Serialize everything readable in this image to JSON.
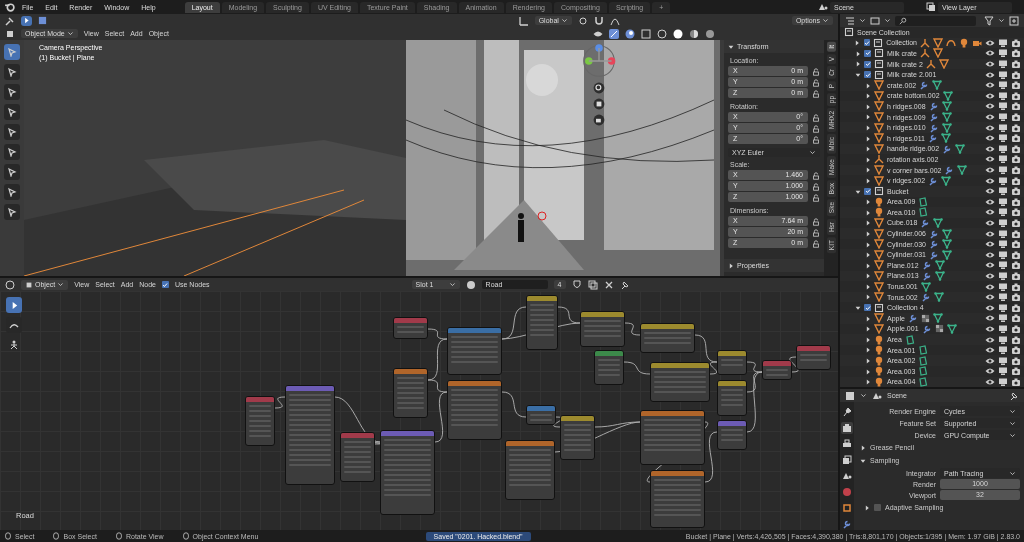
{
  "menu": [
    "File",
    "Edit",
    "Render",
    "Window",
    "Help"
  ],
  "workspaces": [
    {
      "label": "Layout",
      "selected": true
    },
    {
      "label": "Modeling",
      "selected": false
    },
    {
      "label": "Sculpting",
      "selected": false
    },
    {
      "label": "UV Editing",
      "selected": false
    },
    {
      "label": "Texture Paint",
      "selected": false
    },
    {
      "label": "Shading",
      "selected": false
    },
    {
      "label": "Animation",
      "selected": false
    },
    {
      "label": "Rendering",
      "selected": false
    },
    {
      "label": "Compositing",
      "selected": false
    },
    {
      "label": "Scripting",
      "selected": false
    }
  ],
  "add_workspace": "+",
  "scene": {
    "value": "Scene"
  },
  "view_layer": {
    "value": "View Layer"
  },
  "viewport": {
    "mode": "Object Mode",
    "menus": [
      "View",
      "Select",
      "Add",
      "Object"
    ],
    "orientation": "Global",
    "options": "Options",
    "overlay_lines": [
      "Camera Perspective",
      "(1) Bucket | Plane"
    ]
  },
  "transform": {
    "title": "Transform",
    "groups": [
      {
        "label": "Location:",
        "rows": [
          {
            "axis": "X",
            "value": "0 m"
          },
          {
            "axis": "Y",
            "value": "0 m"
          },
          {
            "axis": "Z",
            "value": "0 m"
          }
        ]
      },
      {
        "label": "Rotation:",
        "rows": [
          {
            "axis": "X",
            "value": "0°"
          },
          {
            "axis": "Y",
            "value": "0°"
          },
          {
            "axis": "Z",
            "value": "0°"
          }
        ],
        "mode": "XYZ Euler"
      },
      {
        "label": "Scale:",
        "rows": [
          {
            "axis": "X",
            "value": "1.460"
          },
          {
            "axis": "Y",
            "value": "1.000"
          },
          {
            "axis": "Z",
            "value": "1.000"
          }
        ]
      },
      {
        "label": "Dimensions:",
        "rows": [
          {
            "axis": "X",
            "value": "7.64 m"
          },
          {
            "axis": "Y",
            "value": "20 m"
          },
          {
            "axis": "Z",
            "value": "0 m"
          }
        ]
      }
    ],
    "properties": "Properties"
  },
  "sidebar_tabs": [
    {
      "label": "It",
      "selected": true
    },
    {
      "label": "V",
      "selected": false
    },
    {
      "label": "Cr",
      "selected": false
    },
    {
      "label": "P",
      "selected": false
    },
    {
      "label": "pp",
      "selected": false
    },
    {
      "label": "MHX2",
      "selected": false
    },
    {
      "label": "Mblc",
      "selected": false
    },
    {
      "label": "Make",
      "selected": false
    },
    {
      "label": "Box",
      "selected": false
    },
    {
      "label": "Ske",
      "selected": false
    },
    {
      "label": "Hsr",
      "selected": false
    },
    {
      "label": "KIT",
      "selected": false
    }
  ],
  "node_editor": {
    "type": "Object",
    "menus": [
      "View",
      "Select",
      "Add",
      "Node"
    ],
    "use_nodes": {
      "label": "Use Nodes",
      "checked": true
    },
    "slot": "Slot 1",
    "material": "Road",
    "users": "4",
    "canvas_label": "Road"
  },
  "outliner": {
    "root": "Scene Collection",
    "items": [
      {
        "name": "Collection",
        "kind": "collection",
        "checked": true,
        "expanded": false,
        "badges": [
          {
            "kind": "empty"
          },
          {
            "kind": "mesh"
          },
          {
            "kind": "curve"
          },
          {
            "kind": "light"
          },
          {
            "kind": "camera"
          }
        ]
      },
      {
        "name": "Milk crate",
        "kind": "collection",
        "checked": true,
        "expanded": false,
        "badges": [
          {
            "kind": "empty"
          },
          {
            "kind": "mesh"
          }
        ]
      },
      {
        "name": "Milk crate 2",
        "kind": "collection",
        "checked": true,
        "expanded": false,
        "badges": [
          {
            "kind": "empty"
          },
          {
            "kind": "mesh"
          }
        ]
      },
      {
        "name": "Milk crate 2.001",
        "kind": "collection",
        "checked": true,
        "expanded": true,
        "children": [
          {
            "name": "crate.002",
            "kind": "mesh",
            "badges": [
              {
                "kind": "modifier"
              },
              {
                "kind": "mesh_data"
              }
            ]
          },
          {
            "name": "crate bottom.002",
            "kind": "mesh",
            "badges": [
              {
                "kind": "mesh_data"
              }
            ]
          },
          {
            "name": "h ridges.008",
            "kind": "mesh",
            "badges": [
              {
                "kind": "modifier"
              },
              {
                "kind": "mesh_data"
              }
            ]
          },
          {
            "name": "h ridges.009",
            "kind": "mesh",
            "badges": [
              {
                "kind": "modifier"
              },
              {
                "kind": "mesh_data"
              }
            ]
          },
          {
            "name": "h ridges.010",
            "kind": "mesh",
            "badges": [
              {
                "kind": "modifier"
              },
              {
                "kind": "mesh_data"
              }
            ]
          },
          {
            "name": "h ridges.011",
            "kind": "mesh",
            "badges": [
              {
                "kind": "modifier"
              },
              {
                "kind": "mesh_data"
              }
            ]
          },
          {
            "name": "handle ridge.002",
            "kind": "mesh",
            "badges": [
              {
                "kind": "modifier"
              },
              {
                "kind": "mesh_data"
              }
            ]
          },
          {
            "name": "rotation axis.002",
            "kind": "empty"
          },
          {
            "name": "v corner bars.002",
            "kind": "mesh",
            "badges": [
              {
                "kind": "modifier"
              },
              {
                "kind": "mesh_data"
              }
            ]
          },
          {
            "name": "v ridges.002",
            "kind": "mesh",
            "badges": [
              {
                "kind": "modifier"
              },
              {
                "kind": "mesh_data"
              }
            ]
          }
        ]
      },
      {
        "name": "Bucket",
        "kind": "collection",
        "checked": true,
        "expanded": true,
        "children": [
          {
            "name": "Area.009",
            "kind": "light",
            "badges": [
              {
                "kind": "light_data"
              }
            ]
          },
          {
            "name": "Area.010",
            "kind": "light",
            "badges": [
              {
                "kind": "light_data"
              }
            ]
          },
          {
            "name": "Cube.018",
            "kind": "mesh",
            "badges": [
              {
                "kind": "modifier"
              },
              {
                "kind": "mesh_data"
              }
            ]
          },
          {
            "name": "Cylinder.006",
            "kind": "mesh",
            "badges": [
              {
                "kind": "modifier"
              },
              {
                "kind": "mesh_data"
              }
            ]
          },
          {
            "name": "Cylinder.030",
            "kind": "mesh",
            "badges": [
              {
                "kind": "modifier"
              },
              {
                "kind": "mesh_data"
              }
            ]
          },
          {
            "name": "Cylinder.031",
            "kind": "mesh",
            "badges": [
              {
                "kind": "modifier"
              },
              {
                "kind": "mesh_data"
              }
            ]
          },
          {
            "name": "Plane.012",
            "kind": "mesh",
            "badges": [
              {
                "kind": "modifier"
              },
              {
                "kind": "mesh_data"
              }
            ]
          },
          {
            "name": "Plane.013",
            "kind": "mesh",
            "badges": [
              {
                "kind": "modifier"
              },
              {
                "kind": "mesh_data"
              }
            ]
          },
          {
            "name": "Torus.001",
            "kind": "mesh",
            "badges": [
              {
                "kind": "mesh_data"
              }
            ]
          },
          {
            "name": "Torus.002",
            "kind": "mesh",
            "badges": [
              {
                "kind": "modifier"
              },
              {
                "kind": "mesh_data"
              }
            ]
          }
        ]
      },
      {
        "name": "Collection 4",
        "kind": "collection",
        "checked": true,
        "expanded": true,
        "children": [
          {
            "name": "Apple",
            "kind": "mesh",
            "badges": [
              {
                "kind": "modifier"
              },
              {
                "kind": "material"
              },
              {
                "kind": "mesh_data"
              }
            ]
          },
          {
            "name": "Apple.001",
            "kind": "mesh",
            "badges": [
              {
                "kind": "modifier"
              },
              {
                "kind": "material"
              },
              {
                "kind": "mesh_data"
              }
            ]
          },
          {
            "name": "Area",
            "kind": "light",
            "badges": [
              {
                "kind": "light_data"
              }
            ]
          },
          {
            "name": "Area.001",
            "kind": "light",
            "badges": [
              {
                "kind": "light_data"
              }
            ]
          },
          {
            "name": "Area.002",
            "kind": "light",
            "badges": [
              {
                "kind": "light_data"
              }
            ]
          },
          {
            "name": "Area.003",
            "kind": "light",
            "badges": [
              {
                "kind": "light_data"
              }
            ]
          },
          {
            "name": "Area.004",
            "kind": "light",
            "badges": [
              {
                "kind": "light_data"
              }
            ]
          }
        ]
      }
    ]
  },
  "properties": {
    "context": "Scene",
    "tabs": [
      {
        "kind": "tool",
        "selected": false
      },
      {
        "kind": "render",
        "selected": true
      },
      {
        "kind": "output",
        "selected": false
      },
      {
        "kind": "view_layer",
        "selected": false
      },
      {
        "kind": "scene",
        "selected": false
      },
      {
        "kind": "world",
        "selected": false
      },
      {
        "kind": "object",
        "selected": false
      },
      {
        "kind": "modifier",
        "selected": false
      }
    ],
    "fields": [
      {
        "label": "Render Engine",
        "value": "Cycles"
      },
      {
        "label": "Feature Set",
        "value": "Supported"
      },
      {
        "label": "Device",
        "value": "GPU Compute"
      }
    ],
    "panels": [
      {
        "title": "Grease Pencil",
        "expanded": false
      },
      {
        "title": "Sampling",
        "expanded": true,
        "integrator": {
          "label": "Integrator",
          "value": "Path Tracing"
        },
        "samples": [
          {
            "label": "Render",
            "value": "1000"
          },
          {
            "label": "Viewport",
            "value": "32"
          }
        ],
        "subpanel": {
          "title": "Adaptive Sampling",
          "expanded": false,
          "checked": false
        }
      }
    ]
  },
  "status_bar": {
    "hints": [
      "Select",
      "Box Select",
      "Rotate View",
      "Object Context Menu"
    ],
    "message": "Saved \"0201. Hacked.blend\"",
    "stats": "Bucket | Plane | Verts:4,426,505 | Faces:4,390,380 | Tris:8,801,170 | Objects:1/395 | Mem: 1.97 GiB | 2.83.0"
  }
}
